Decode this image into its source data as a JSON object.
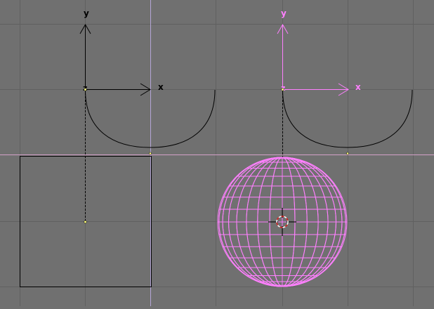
{
  "viewport": {
    "background": "#707070",
    "grid_color": "#606060",
    "selected_color": "#ff80ff",
    "wire_color": "#000000"
  },
  "left_object": {
    "axes": {
      "x_label": "x",
      "y_label": "y",
      "z_label": "z"
    },
    "curve_name": "bezier-curve-arc",
    "plane_name": "square-plane"
  },
  "right_object": {
    "axes": {
      "x_label": "x",
      "y_label": "y",
      "z_label": "z"
    },
    "curve_name": "bezier-curve-arc",
    "sphere_name": "uv-sphere",
    "selected": true
  },
  "cursor": {
    "icon": "3d-cursor-icon"
  }
}
